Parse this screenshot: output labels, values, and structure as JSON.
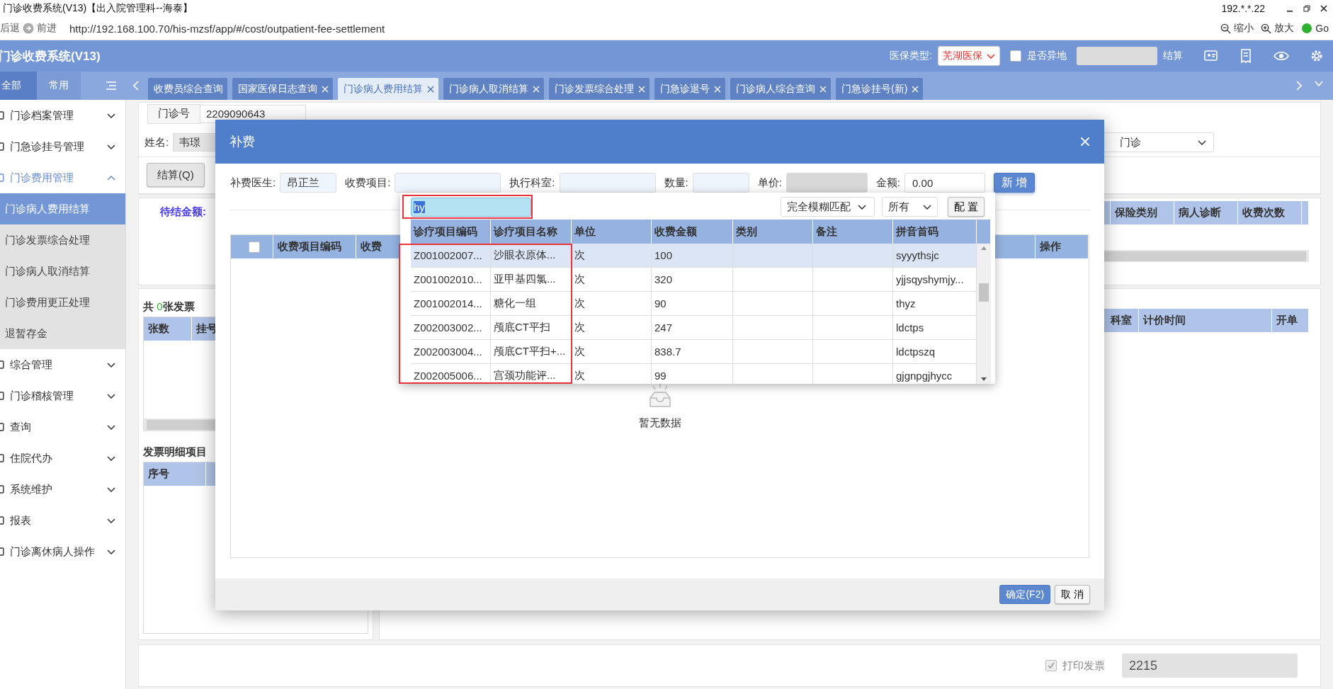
{
  "window": {
    "title": "门诊收费系统(V13)【出入院管理科--海泰】",
    "host": "192.*.*.22"
  },
  "browser": {
    "back": "后退",
    "forward": "前进",
    "url": "http://192.168.100.70/his-mzsf/app/#/cost/outpatient-fee-settlement",
    "zoom_out": "缩小",
    "zoom_in": "放大",
    "go": "Go"
  },
  "header": {
    "title": "门诊收费系统(V13)",
    "insurance_label": "医保类型:",
    "insurance_value": "芜湖医保",
    "remote_checked": false,
    "remote_label": "是否异地",
    "settle": "结算"
  },
  "sidebar": {
    "tabs": [
      {
        "label": "全部",
        "selected": true
      },
      {
        "label": "常用",
        "selected": false
      }
    ],
    "items": [
      {
        "label": "门诊档案管理",
        "expanded": false
      },
      {
        "label": "门急诊挂号管理",
        "expanded": false
      },
      {
        "label": "门诊费用管理",
        "expanded": true,
        "children": [
          {
            "label": "门诊病人费用结算",
            "selected": true
          },
          {
            "label": "门诊发票综合处理",
            "selected": false
          },
          {
            "label": "门诊病人取消结算",
            "selected": false
          },
          {
            "label": "门诊费用更正处理",
            "selected": false
          },
          {
            "label": "退暂存金",
            "selected": false
          }
        ]
      },
      {
        "label": "综合管理",
        "expanded": false
      },
      {
        "label": "门诊稽核管理",
        "expanded": false
      },
      {
        "label": "查询",
        "expanded": false
      },
      {
        "label": "住院代办",
        "expanded": false
      },
      {
        "label": "系统维护",
        "expanded": false
      },
      {
        "label": "报表",
        "expanded": false
      },
      {
        "label": "门诊离休病人操作",
        "expanded": false
      }
    ]
  },
  "tabs": [
    {
      "label": "收费员综合查询",
      "selected": false,
      "closable": false
    },
    {
      "label": "国家医保日志查询",
      "selected": false,
      "closable": true
    },
    {
      "label": "门诊病人费用结算",
      "selected": true,
      "closable": true
    },
    {
      "label": "门诊病人取消结算",
      "selected": false,
      "closable": true
    },
    {
      "label": "门诊发票综合处理",
      "selected": false,
      "closable": true
    },
    {
      "label": "门急诊退号",
      "selected": false,
      "closable": true
    },
    {
      "label": "门诊病人综合查询",
      "selected": false,
      "closable": true
    },
    {
      "label": "门急诊挂号(新)",
      "selected": false,
      "closable": true
    }
  ],
  "main": {
    "visit_no_label": "门诊号",
    "visit_no": "2209090643",
    "name_label": "姓名:",
    "name": "韦璟",
    "visit_type": "门诊",
    "settle_button": "结算(Q)",
    "pending_label": "待结金额:",
    "insurance_table": {
      "columns": [
        "保险类别",
        "病人诊断",
        "收费次数"
      ]
    },
    "invoice_count": {
      "prefix": "共 ",
      "count": "0",
      "suffix": "张发票"
    },
    "invoice_table": {
      "columns": [
        "张数",
        "挂号"
      ]
    },
    "detail_title": "发票明细项目",
    "detail_table": {
      "columns": [
        "序号"
      ]
    },
    "order_table": {
      "columns": [
        "科室",
        "计价时间",
        "开单"
      ]
    },
    "print_invoice": {
      "label": "打印发票",
      "checked": true
    },
    "invoice_no": "2215"
  },
  "dialog": {
    "title": "补费",
    "fields": [
      {
        "label": "补费医生:",
        "value": "昂正兰",
        "kind": "input"
      },
      {
        "label": "收费项目:",
        "kind": "input"
      },
      {
        "label": "执行科室:",
        "kind": "input"
      },
      {
        "label": "数量:",
        "kind": "input"
      },
      {
        "label": "单价:",
        "kind": "readonly"
      },
      {
        "label": "金额:",
        "value": "0.00",
        "kind": "input"
      }
    ],
    "add_button": "新 增",
    "table": {
      "select_all_checked": false,
      "columns": [
        "收费项目编码",
        "收费",
        "操作"
      ],
      "empty": "暂无数据"
    },
    "ok": "确定(F2)",
    "cancel": "取 消"
  },
  "lookup": {
    "search_highlighted": true,
    "code_name_highlighted": true,
    "query": "hy",
    "match_mode": "完全模糊匹配",
    "scope": "所有",
    "config": "配 置",
    "columns": [
      "诊疗项目编码",
      "诊疗项目名称",
      "单位",
      "收费金额",
      "类别",
      "备注",
      "拼音首码"
    ],
    "rows": [
      {
        "selected": true,
        "cells": [
          "Z001002007...",
          "沙眼衣原体...",
          "次",
          "100",
          "",
          "",
          "syyythsjc"
        ]
      },
      {
        "selected": false,
        "cells": [
          "Z001002010...",
          "亚甲基四氯...",
          "次",
          "320",
          "",
          "",
          "yjjsqyshymjy..."
        ]
      },
      {
        "selected": false,
        "cells": [
          "Z001002014...",
          "糖化一组",
          "次",
          "90",
          "",
          "",
          "thyz"
        ]
      },
      {
        "selected": false,
        "cells": [
          "Z002003002...",
          "颅底CT平扫",
          "次",
          "247",
          "",
          "",
          "ldctps"
        ]
      },
      {
        "selected": false,
        "cells": [
          "Z002003004...",
          "颅底CT平扫+...",
          "次",
          "838.7",
          "",
          "",
          "ldctpszq"
        ]
      },
      {
        "selected": false,
        "cells": [
          "Z002005006...",
          "宫颈功能评...",
          "次",
          "99",
          "",
          "",
          "gjgnpgjhycc"
        ]
      }
    ]
  }
}
